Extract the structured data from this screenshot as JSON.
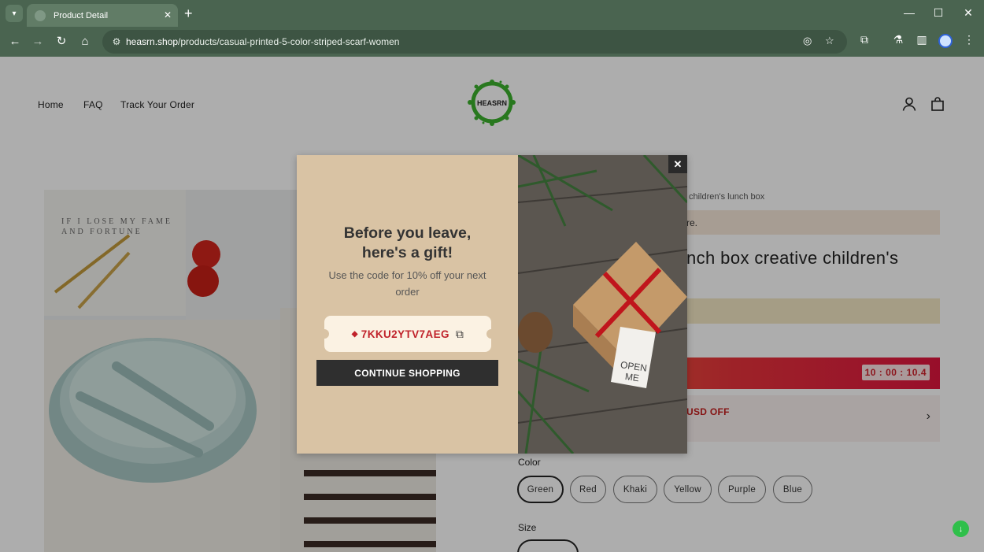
{
  "browser": {
    "tab_title": "Product Detail",
    "tab_close": "✕",
    "new_tab": "+",
    "url_host": "heasrn.shop",
    "url_path": "/products/casual-printed-5-color-striped-scarf-women",
    "window_minimize": "—",
    "window_maximize": "☐",
    "window_close": "✕"
  },
  "site": {
    "nav": [
      "Home",
      "FAQ",
      "Track Your Order"
    ],
    "logo_text": "HEASRN"
  },
  "product": {
    "breadcrumb": "children's lunch box",
    "notice": "re.",
    "title": "nch box creative children's",
    "timer": "10 : 00 : 10.4",
    "coupon_text": "USD OFF",
    "coupon_chevron": "›",
    "color_label": "Color",
    "colors": [
      "Green",
      "Red",
      "Khaki",
      "Yellow",
      "Purple",
      "Blue"
    ],
    "selected_color": "Green",
    "size_label": "Size"
  },
  "image_text": {
    "book_line1": "IF I LOSE MY FAME",
    "book_line2": "AND FORTUNE",
    "gift_tag_1": "OPEN",
    "gift_tag_2": "ME"
  },
  "popup": {
    "heading_line1": "Before you leave,",
    "heading_line2": "here's a gift!",
    "subtext": "Use the code for 10% off your next order",
    "code": "7KKU2YTV7AEG",
    "continue_label": "CONTINUE SHOPPING",
    "close_label": "✕"
  },
  "colors": {
    "browser_frame": "#4a6450",
    "popup_bg": "#d9c3a4",
    "code_red": "#c0222a",
    "flash_gradient_end": "#e1163f"
  }
}
